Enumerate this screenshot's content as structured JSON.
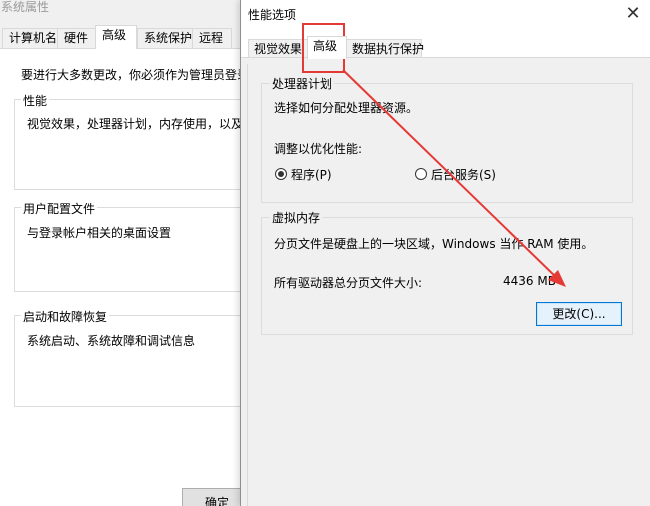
{
  "system_properties": {
    "title": "系统属性",
    "tabs": [
      {
        "label": "计算机名"
      },
      {
        "label": "硬件"
      },
      {
        "label": "高级"
      },
      {
        "label": "系统保护"
      },
      {
        "label": "远程"
      }
    ],
    "admin_note": "要进行大多数更改，你必须作为管理员登录",
    "groups": {
      "performance": {
        "title": "性能",
        "description": "视觉效果，处理器计划，内存使用，以及虚"
      },
      "user_profiles": {
        "title": "用户配置文件",
        "description": "与登录帐户相关的桌面设置"
      },
      "startup_recovery": {
        "title": "启动和故障恢复",
        "description": "系统启动、系统故障和调试信息"
      }
    },
    "ok_button": "确定"
  },
  "performance_options": {
    "title": "性能选项",
    "close_glyph": "✕",
    "tabs": [
      {
        "label": "视觉效果"
      },
      {
        "label": "高级"
      },
      {
        "label": "数据执行保护"
      }
    ],
    "processor_scheduling": {
      "title": "处理器计划",
      "description": "选择如何分配处理器资源。",
      "adjust_label": "调整以优化性能:",
      "options": [
        {
          "label": "程序(P)",
          "checked": true
        },
        {
          "label": "后台服务(S)",
          "checked": false
        }
      ]
    },
    "virtual_memory": {
      "title": "虚拟内存",
      "description": "分页文件是硬盘上的一块区域，Windows 当作 RAM 使用。",
      "total_label": "所有驱动器总分页文件大小:",
      "total_value": "4436 MB",
      "change_button": "更改(C)..."
    }
  },
  "annotation": {
    "color": "#e53935"
  }
}
